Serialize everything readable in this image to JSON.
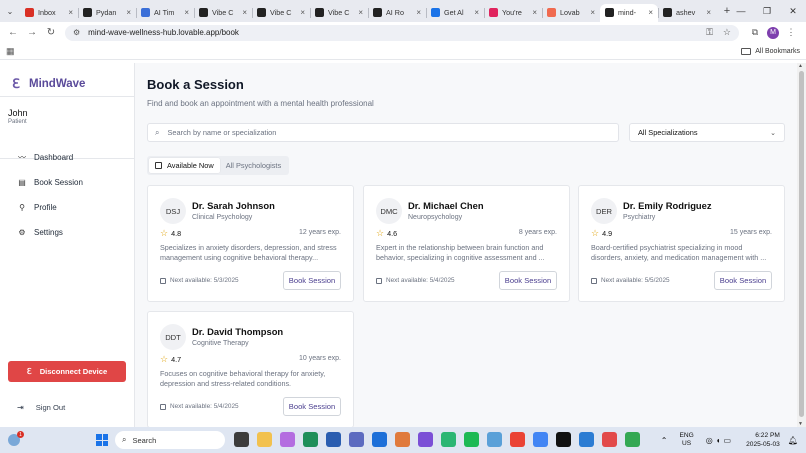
{
  "browser": {
    "tabs": [
      {
        "title": "Inbox",
        "color": "#d93025",
        "active": false
      },
      {
        "title": "Pydan",
        "color": "#222222",
        "active": false
      },
      {
        "title": "AI Tim",
        "color": "#3b6fd8",
        "active": false
      },
      {
        "title": "Vibe C",
        "color": "#222222",
        "active": false
      },
      {
        "title": "Vibe C",
        "color": "#222222",
        "active": false
      },
      {
        "title": "Vibe C",
        "color": "#222222",
        "active": false
      },
      {
        "title": "AI Ro",
        "color": "#222222",
        "active": false
      },
      {
        "title": "Get Al",
        "color": "#1a73e8",
        "active": false
      },
      {
        "title": "You're",
        "color": "#e0245e",
        "active": false
      },
      {
        "title": "Lovab",
        "color": "#f06a4f",
        "active": false
      },
      {
        "title": "mind-",
        "color": "#222222",
        "active": true
      },
      {
        "title": "ashev",
        "color": "#222222",
        "active": false
      }
    ],
    "url": "mind-wave-wellness-hub.lovable.app/book",
    "profile_initial": "M",
    "all_bookmarks_label": "All Bookmarks"
  },
  "sidebar": {
    "brand": "MindWave",
    "user_name": "John",
    "user_role": "Patient",
    "items": [
      {
        "label": "Dashboard",
        "icon": "dashboard-icon"
      },
      {
        "label": "Book Session",
        "icon": "calendar-icon"
      },
      {
        "label": "Profile",
        "icon": "user-icon"
      },
      {
        "label": "Settings",
        "icon": "gear-icon"
      }
    ],
    "disconnect_label": "Disconnect Device",
    "signout_label": "Sign Out"
  },
  "main": {
    "title": "Book a Session",
    "subtitle": "Find and book an appointment with a mental health professional",
    "search_placeholder": "Search by name or specialization",
    "specialization_value": "All Specializations",
    "tabs": [
      {
        "label": "Available Now",
        "active": true
      },
      {
        "label": "All Psychologists",
        "active": false
      }
    ],
    "doctors": [
      {
        "initials": "DSJ",
        "name": "Dr. Sarah Johnson",
        "specialty": "Clinical Psychology",
        "rating": "4.8",
        "experience": "12 years exp.",
        "description": "Specializes in anxiety disorders, depression, and stress management using cognitive behavioral therapy...",
        "next_available": "Next available: 5/3/2025",
        "button": "Book Session"
      },
      {
        "initials": "DMC",
        "name": "Dr. Michael Chen",
        "specialty": "Neuropsychology",
        "rating": "4.6",
        "experience": "8 years exp.",
        "description": "Expert in the relationship between brain function and behavior, specializing in cognitive assessment and ...",
        "next_available": "Next available: 5/4/2025",
        "button": "Book Session"
      },
      {
        "initials": "DER",
        "name": "Dr. Emily Rodriguez",
        "specialty": "Psychiatry",
        "rating": "4.9",
        "experience": "15 years exp.",
        "description": "Board-certified psychiatrist specializing in mood disorders, anxiety, and medication management with ...",
        "next_available": "Next available: 5/5/2025",
        "button": "Book Session"
      },
      {
        "initials": "DDT",
        "name": "Dr. David Thompson",
        "specialty": "Cognitive Therapy",
        "rating": "4.7",
        "experience": "10 years exp.",
        "description": "Focuses on cognitive behavioral therapy for anxiety, depression and stress-related conditions.",
        "next_available": "Next available: 5/4/2025",
        "button": "Book Session"
      }
    ]
  },
  "taskbar": {
    "weather_badge": "1",
    "search_label": "Search",
    "lang_top": "ENG",
    "lang_bottom": "US",
    "time": "6:22 PM",
    "date": "2025-05-03"
  },
  "colors": {
    "accent": "#5a4a9a",
    "danger": "#e04646",
    "star": "#e0a410"
  }
}
